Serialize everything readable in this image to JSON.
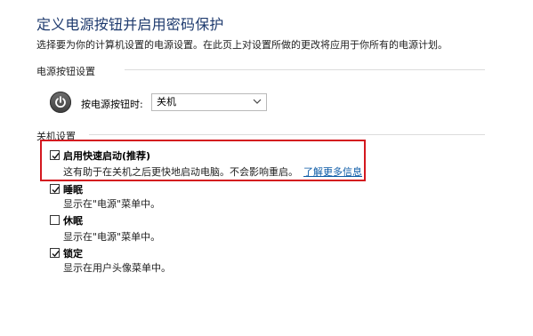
{
  "page": {
    "title": "定义电源按钮并启用密码保护",
    "description": "选择要为你的计算机设置的电源设置。在此页上对设置所做的更改将应用于你所有的电源计划。"
  },
  "power_button_section": {
    "label": "电源按钮设置",
    "row_label": "按电源按钮时:",
    "select_value": "关机"
  },
  "shutdown_section": {
    "label": "关机设置",
    "options": [
      {
        "label": "启用快速启动(推荐)",
        "desc": "这有助于在关机之后更快地启动电脑。不会影响重启。",
        "link": "了解更多信息",
        "checked": true
      },
      {
        "label": "睡眠",
        "desc": "显示在\"电源\"菜单中。",
        "checked": true
      },
      {
        "label": "休眠",
        "desc": "显示在\"电源\"菜单中。",
        "checked": false
      },
      {
        "label": "锁定",
        "desc": "显示在用户头像菜单中。",
        "checked": true
      }
    ]
  },
  "colors": {
    "title": "#1e3a6e",
    "link": "#0a5aa6",
    "highlight_border": "#d4181f"
  },
  "icons": {
    "power": "power-icon",
    "chevron": "chevron-down-icon",
    "check": "checkmark-icon"
  }
}
